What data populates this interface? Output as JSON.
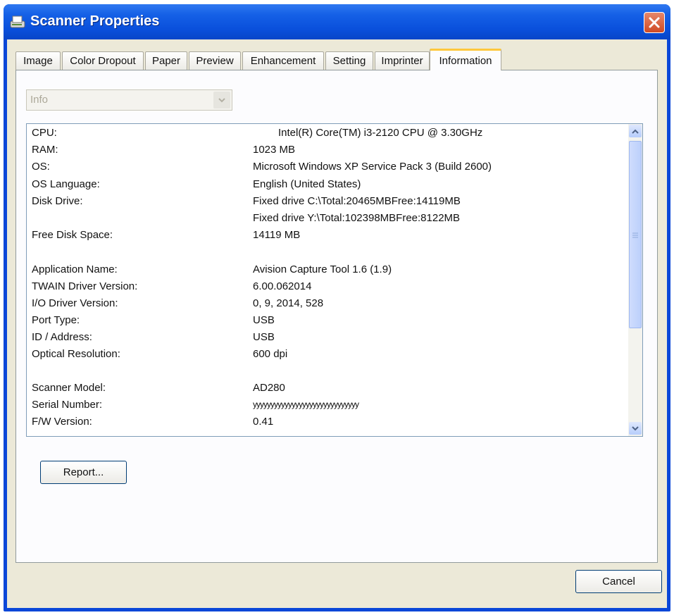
{
  "window": {
    "title": "Scanner Properties"
  },
  "tabs": [
    "Image",
    "Color Dropout",
    "Paper",
    "Preview",
    "Enhancement",
    "Setting",
    "Imprinter",
    "Information"
  ],
  "active_tab": "Information",
  "combo": {
    "value": "Info"
  },
  "info_rows": [
    {
      "label": "CPU:",
      "value": "Intel(R) Core(TM) i3-2120 CPU @ 3.30GHz"
    },
    {
      "label": "RAM:",
      "value": "1023 MB"
    },
    {
      "label": "OS:",
      "value": "Microsoft Windows XP Service Pack 3 (Build 2600)"
    },
    {
      "label": "OS Language:",
      "value": "English (United States)"
    },
    {
      "label": "Disk Drive:",
      "value": "Fixed drive C:\\Total:20465MBFree:14119MB"
    },
    {
      "label": "",
      "value": "Fixed drive Y:\\Total:102398MBFree:8122MB"
    },
    {
      "label": "Free Disk Space:",
      "value": "14119 MB"
    },
    {
      "label": "Application Name:",
      "value": "Avision Capture Tool 1.6 (1.9)"
    },
    {
      "label": "TWAIN Driver Version:",
      "value": "6.00.062014"
    },
    {
      "label": "I/O Driver Version:",
      "value": "0, 9, 2014, 528"
    },
    {
      "label": "Port Type:",
      "value": "USB"
    },
    {
      "label": "ID / Address:",
      "value": "USB"
    },
    {
      "label": "Optical Resolution:",
      "value": "600 dpi"
    },
    {
      "label": "Scanner Model:",
      "value": "AD280"
    },
    {
      "label": "Serial Number:",
      "value": "yyyyyyyyyyyyyyyyyyyyyyyyyyyyyy"
    },
    {
      "label": "F/W Version:",
      "value": "0.41"
    }
  ],
  "buttons": {
    "report": "Report...",
    "cancel": "Cancel"
  }
}
